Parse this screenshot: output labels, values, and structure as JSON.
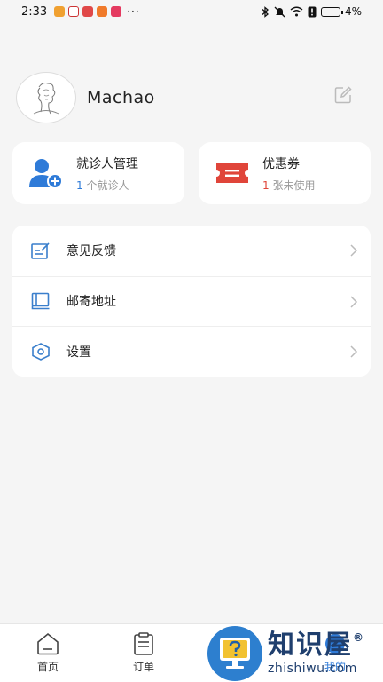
{
  "status_bar": {
    "time": "2:33",
    "battery": "4%",
    "more": "···",
    "icons": [
      "message-app-icon",
      "app-icon",
      "notification-icon",
      "video-app-icon",
      "app-icon",
      "bluetooth-icon",
      "mute-icon",
      "wifi-icon",
      "alert-icon",
      "battery-icon"
    ]
  },
  "profile": {
    "username": "Machao",
    "avatar_icon": "avatar-sketch",
    "edit_icon": "edit-icon"
  },
  "cards": {
    "patient": {
      "title": "就诊人管理",
      "count": "1",
      "subtitle": "个就诊人",
      "icon": "add-user-icon",
      "accent": "#2f7bd8"
    },
    "coupon": {
      "title": "优惠券",
      "count": "1",
      "subtitle": "张未使用",
      "icon": "ticket-icon",
      "accent": "#e0453a"
    }
  },
  "menu": {
    "items": [
      {
        "label": "意见反馈",
        "icon": "feedback-icon"
      },
      {
        "label": "邮寄地址",
        "icon": "book-icon"
      },
      {
        "label": "设置",
        "icon": "settings-icon"
      }
    ]
  },
  "tabs": [
    {
      "label": "首页",
      "icon": "home-icon"
    },
    {
      "label": "订单",
      "icon": "order-clipboard-icon"
    },
    {
      "label": "",
      "icon": ""
    },
    {
      "label": "我的",
      "icon": "profile-icon",
      "active": true
    }
  ],
  "watermark": {
    "chinese": "知识屋",
    "registered": "®",
    "latin": "zhishiwu.com",
    "icon": "question-monitor-icon"
  }
}
